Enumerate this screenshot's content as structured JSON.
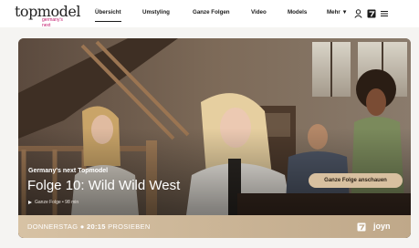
{
  "brand": {
    "logo_main": "topmodel",
    "logo_sub": "germany's next"
  },
  "nav": {
    "items": [
      {
        "label": "Übersicht",
        "active": true
      },
      {
        "label": "Umstyling",
        "active": false
      },
      {
        "label": "Ganze Folgen",
        "active": false
      },
      {
        "label": "Video",
        "active": false
      },
      {
        "label": "Models",
        "active": false
      },
      {
        "label": "Mehr ▼",
        "active": false
      }
    ],
    "icons": [
      "user-icon",
      "prosieben-icon",
      "hamburger-icon"
    ]
  },
  "hero": {
    "show_name": "Germany's next Topmodel",
    "episode_title": "Folge 10: Wild Wild West",
    "meta": "Ganze Folge • 98 min",
    "cta_label": "Ganze Folge anschauen",
    "airtime": {
      "day": "DONNERSTAG",
      "separator": "●",
      "time": "20:15",
      "channel": "PROSIEBEN"
    },
    "partner_logo": "joyn"
  },
  "colors": {
    "accent_pink": "#c2186b",
    "cta_background": "#d8c0a0",
    "bottom_bar": "#d7c2a4"
  }
}
